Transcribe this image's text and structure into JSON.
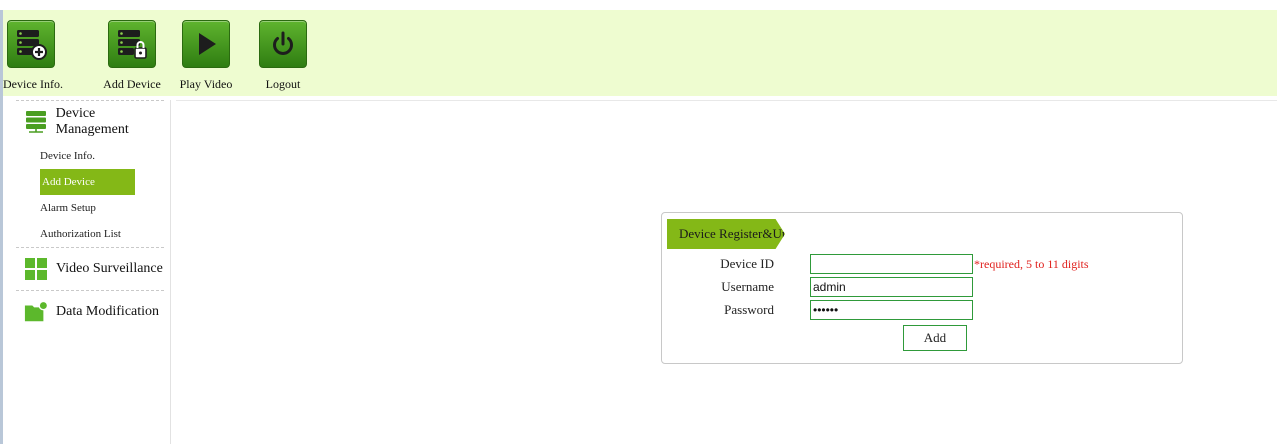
{
  "toolbar": {
    "items": [
      {
        "label": "Device Info.",
        "icon": "server-add-icon"
      },
      {
        "label": "Add Device",
        "icon": "server-lock-icon"
      },
      {
        "label": "Play Video",
        "icon": "play-icon"
      },
      {
        "label": "Logout",
        "icon": "power-icon"
      }
    ]
  },
  "sidebar": {
    "sections": [
      {
        "title": "Device Management",
        "icon": "server-icon",
        "items": [
          {
            "label": "Device Info.",
            "active": false
          },
          {
            "label": "Add Device",
            "active": true
          },
          {
            "label": "Alarm Setup",
            "active": false
          },
          {
            "label": "Authorization List",
            "active": false
          }
        ]
      },
      {
        "title": "Video Surveillance",
        "icon": "grid-icon"
      },
      {
        "title": "Data Modification",
        "icon": "folder-icon"
      }
    ]
  },
  "form": {
    "title": "Device Register&Update",
    "device_id": {
      "label": "Device ID",
      "value": "",
      "hint": "*required, 5 to 11 digits"
    },
    "username": {
      "label": "Username",
      "value": "admin"
    },
    "password": {
      "label": "Password",
      "value": "123456"
    },
    "add_label": "Add"
  },
  "colors": {
    "accent": "#84b817",
    "toolbar_bg": "#eefcd0",
    "icon_green": "#3e9419",
    "hint_red": "#e0201d"
  }
}
